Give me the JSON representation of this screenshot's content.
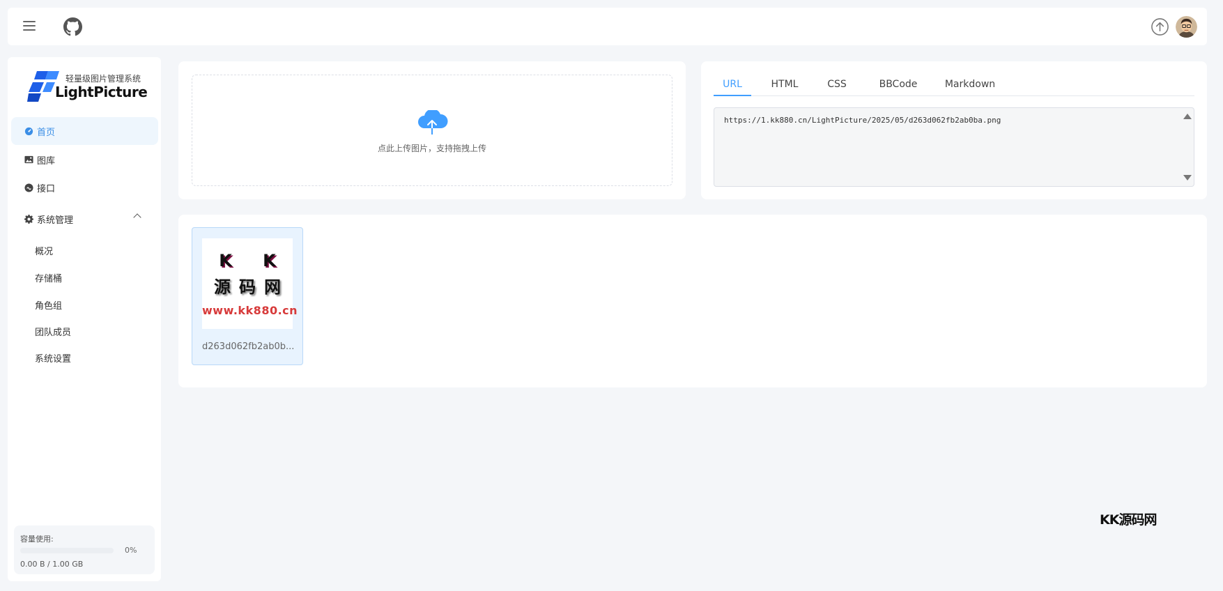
{
  "topbar": {
    "menu_icon": "hamburger-icon",
    "github_icon": "github-icon",
    "upload_icon": "upload-circle-icon",
    "avatar_icon": "user-avatar"
  },
  "sidebar": {
    "logo": {
      "tagline": "轻量级图片管理系统",
      "brand": "LightPicture"
    },
    "items": [
      {
        "label": "首页",
        "icon": "dashboard-icon",
        "active": true
      },
      {
        "label": "图库",
        "icon": "image-icon"
      },
      {
        "label": "接口",
        "icon": "api-icon"
      },
      {
        "label": "系统管理",
        "icon": "gear-icon",
        "expanded": true
      }
    ],
    "sub_items": [
      {
        "label": "概况"
      },
      {
        "label": "存储桶"
      },
      {
        "label": "角色组"
      },
      {
        "label": "团队成员"
      },
      {
        "label": "系统设置"
      }
    ],
    "usage": {
      "title": "容量使用:",
      "percent_label": "0%",
      "percent": 0,
      "capacity": "0.00 B / 1.00 GB"
    }
  },
  "upload": {
    "icon": "cloud-upload-icon",
    "hint": "点此上传图片，支持拖拽上传"
  },
  "links": {
    "tabs": [
      {
        "label": "URL",
        "active": true
      },
      {
        "label": "HTML"
      },
      {
        "label": "CSS"
      },
      {
        "label": "BBCode"
      },
      {
        "label": "Markdown"
      }
    ],
    "value": "https://1.kk880.cn/LightPicture/2025/05/d263d062fb2ab0ba.png"
  },
  "gallery": {
    "items": [
      {
        "filename": "d263d062fb2ab0b...",
        "thumb_line1": "K K",
        "thumb_line2": "源码网",
        "thumb_line3": "www.kk880.cn"
      }
    ]
  },
  "watermark": "KK源码网",
  "colors": {
    "accent": "#409eff",
    "background": "#f4f6f9",
    "active_bg": "#eef6fd"
  }
}
